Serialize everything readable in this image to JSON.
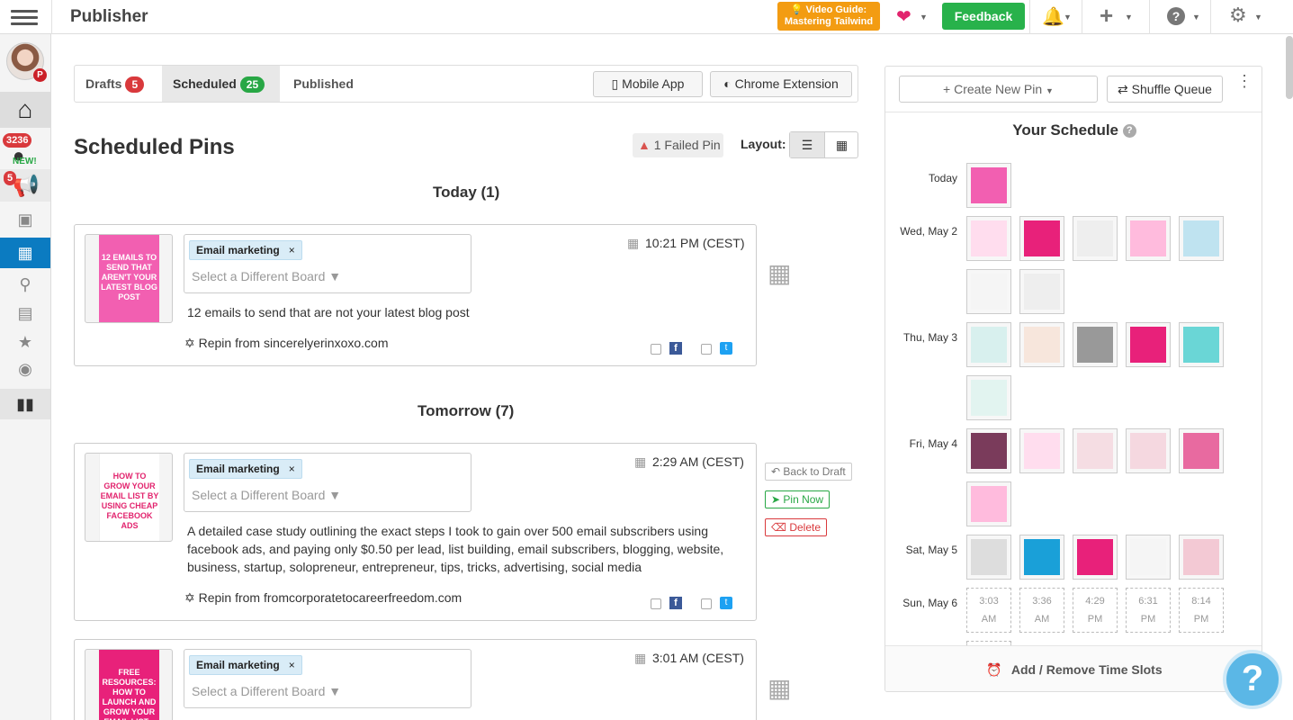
{
  "header": {
    "title": "Publisher",
    "video_guide_line1": "💡 Video Guide:",
    "video_guide_line2": "Mastering Tailwind",
    "feedback": "Feedback"
  },
  "sidebar": {
    "notif_count": "3236",
    "new_label": "NEW!",
    "campaign_count": "5"
  },
  "tabs": [
    {
      "label": "Drafts",
      "count": "5"
    },
    {
      "label": "Scheduled",
      "count": "25"
    },
    {
      "label": "Published"
    }
  ],
  "toolbar": {
    "mobile_app": "Mobile App",
    "chrome_extension": "Chrome Extension"
  },
  "main": {
    "title": "Scheduled Pins",
    "failed_pin": "1 Failed Pin",
    "layout_label": "Layout:"
  },
  "groups": {
    "today": "Today (1)",
    "tomorrow": "Tomorrow (7)"
  },
  "pins": [
    {
      "thumb_text": "12 EMAILS TO SEND THAT AREN'T YOUR LATEST BLOG POST",
      "board": "Email marketing",
      "board_remove": "×",
      "board_placeholder": "Select a Different Board ▼",
      "time": "10:21 PM (CEST)",
      "description": "12 emails to send that are not your latest blog post",
      "repin": "Repin from sincerelyerinxoxo.com"
    },
    {
      "thumb_text": "HOW TO GROW YOUR EMAIL LIST BY USING CHEAP FACEBOOK ADS",
      "board": "Email marketing",
      "board_remove": "×",
      "board_placeholder": "Select a Different Board ▼",
      "time": "2:29 AM (CEST)",
      "description": "A detailed case study outlining the exact steps I took to gain over 500 email subscribers using facebook ads, and paying only $0.50 per lead, list building, email subscribers, blogging, website, business, startup, solopreneur, entrepreneur, tips, tricks, advertising, social media",
      "repin": "Repin from fromcorporatetocareerfreedom.com"
    },
    {
      "thumb_text": "FREE RESOURCES: HOW TO LAUNCH AND GROW YOUR EMAIL LIST... FAST",
      "board": "Email marketing",
      "board_remove": "×",
      "board_placeholder": "Select a Different Board ▼",
      "time": "3:01 AM (CEST)"
    }
  ],
  "pin_actions": {
    "back_to_draft": "Back to Draft",
    "pin_now": "Pin Now",
    "delete": "Delete"
  },
  "schedule": {
    "create_new_pin": "Create New Pin",
    "shuffle_queue": "Shuffle Queue",
    "title": "Your Schedule",
    "days": [
      "Today",
      "Wed, May 2",
      "Thu, May 3",
      "Fri, May 4",
      "Sat, May 5",
      "Sun, May 6"
    ],
    "slot_times": [
      "3:03",
      "3:36",
      "4:29",
      "6:31",
      "8:14"
    ],
    "slot_periods": [
      "AM",
      "AM",
      "PM",
      "PM",
      "PM"
    ],
    "add_remove_slots": "Add / Remove Time Slots"
  },
  "colors": {
    "brand_pink": "#e2246e",
    "feedback_green": "#28b24b",
    "active_blue": "#0b7bc1",
    "badge_red": "#d9393c",
    "badge_green": "#28a745",
    "video_orange": "#f39c12"
  }
}
